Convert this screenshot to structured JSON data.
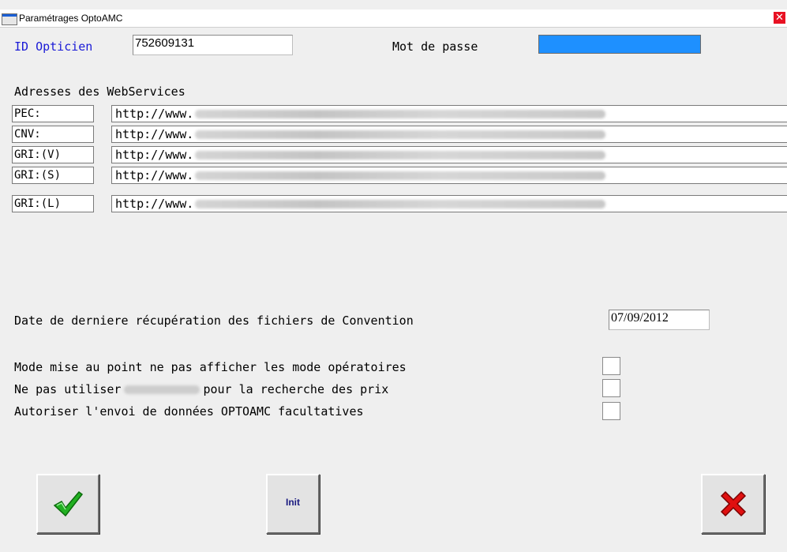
{
  "window": {
    "title": "Paramétrages OptoAMC",
    "close_glyph": "✕"
  },
  "credentials": {
    "id_label": "ID Opticien",
    "id_value": "752609131",
    "password_label": "Mot de passe",
    "password_value": ""
  },
  "webservices": {
    "heading": "Adresses des WebServices",
    "rows": [
      {
        "code": "PEC:",
        "url_prefix": "http://www."
      },
      {
        "code": "CNV:",
        "url_prefix": "http://www."
      },
      {
        "code": "GRI:(V)",
        "url_prefix": "http://www."
      },
      {
        "code": "GRI:(S)",
        "url_prefix": "http://www."
      },
      {
        "code": "GRI:(L)",
        "url_prefix": "http://www."
      }
    ]
  },
  "convention": {
    "label": "Date de derniere récupération des fichiers de Convention",
    "date": "07/09/2012"
  },
  "options": {
    "debug_mode_label": "Mode mise au point ne pas afficher les mode opératoires",
    "no_price_grid_label_start": "Ne pas utiliser",
    "no_price_grid_label_end": "pour la recherche des prix",
    "optional_data_label": "Autoriser l'envoi de données OPTOAMC facultatives",
    "debug_mode_checked": false,
    "no_price_grid_checked": false,
    "optional_data_checked": false
  },
  "buttons": {
    "ok_icon": "checkmark-icon",
    "init_label": "Init",
    "cancel_icon": "red-x-icon"
  },
  "colors": {
    "id_label": "#1a1ad6",
    "password_field": "#1e90ff",
    "close_button": "#e81123",
    "check_green": "#22b022",
    "cancel_red": "#e01010"
  }
}
